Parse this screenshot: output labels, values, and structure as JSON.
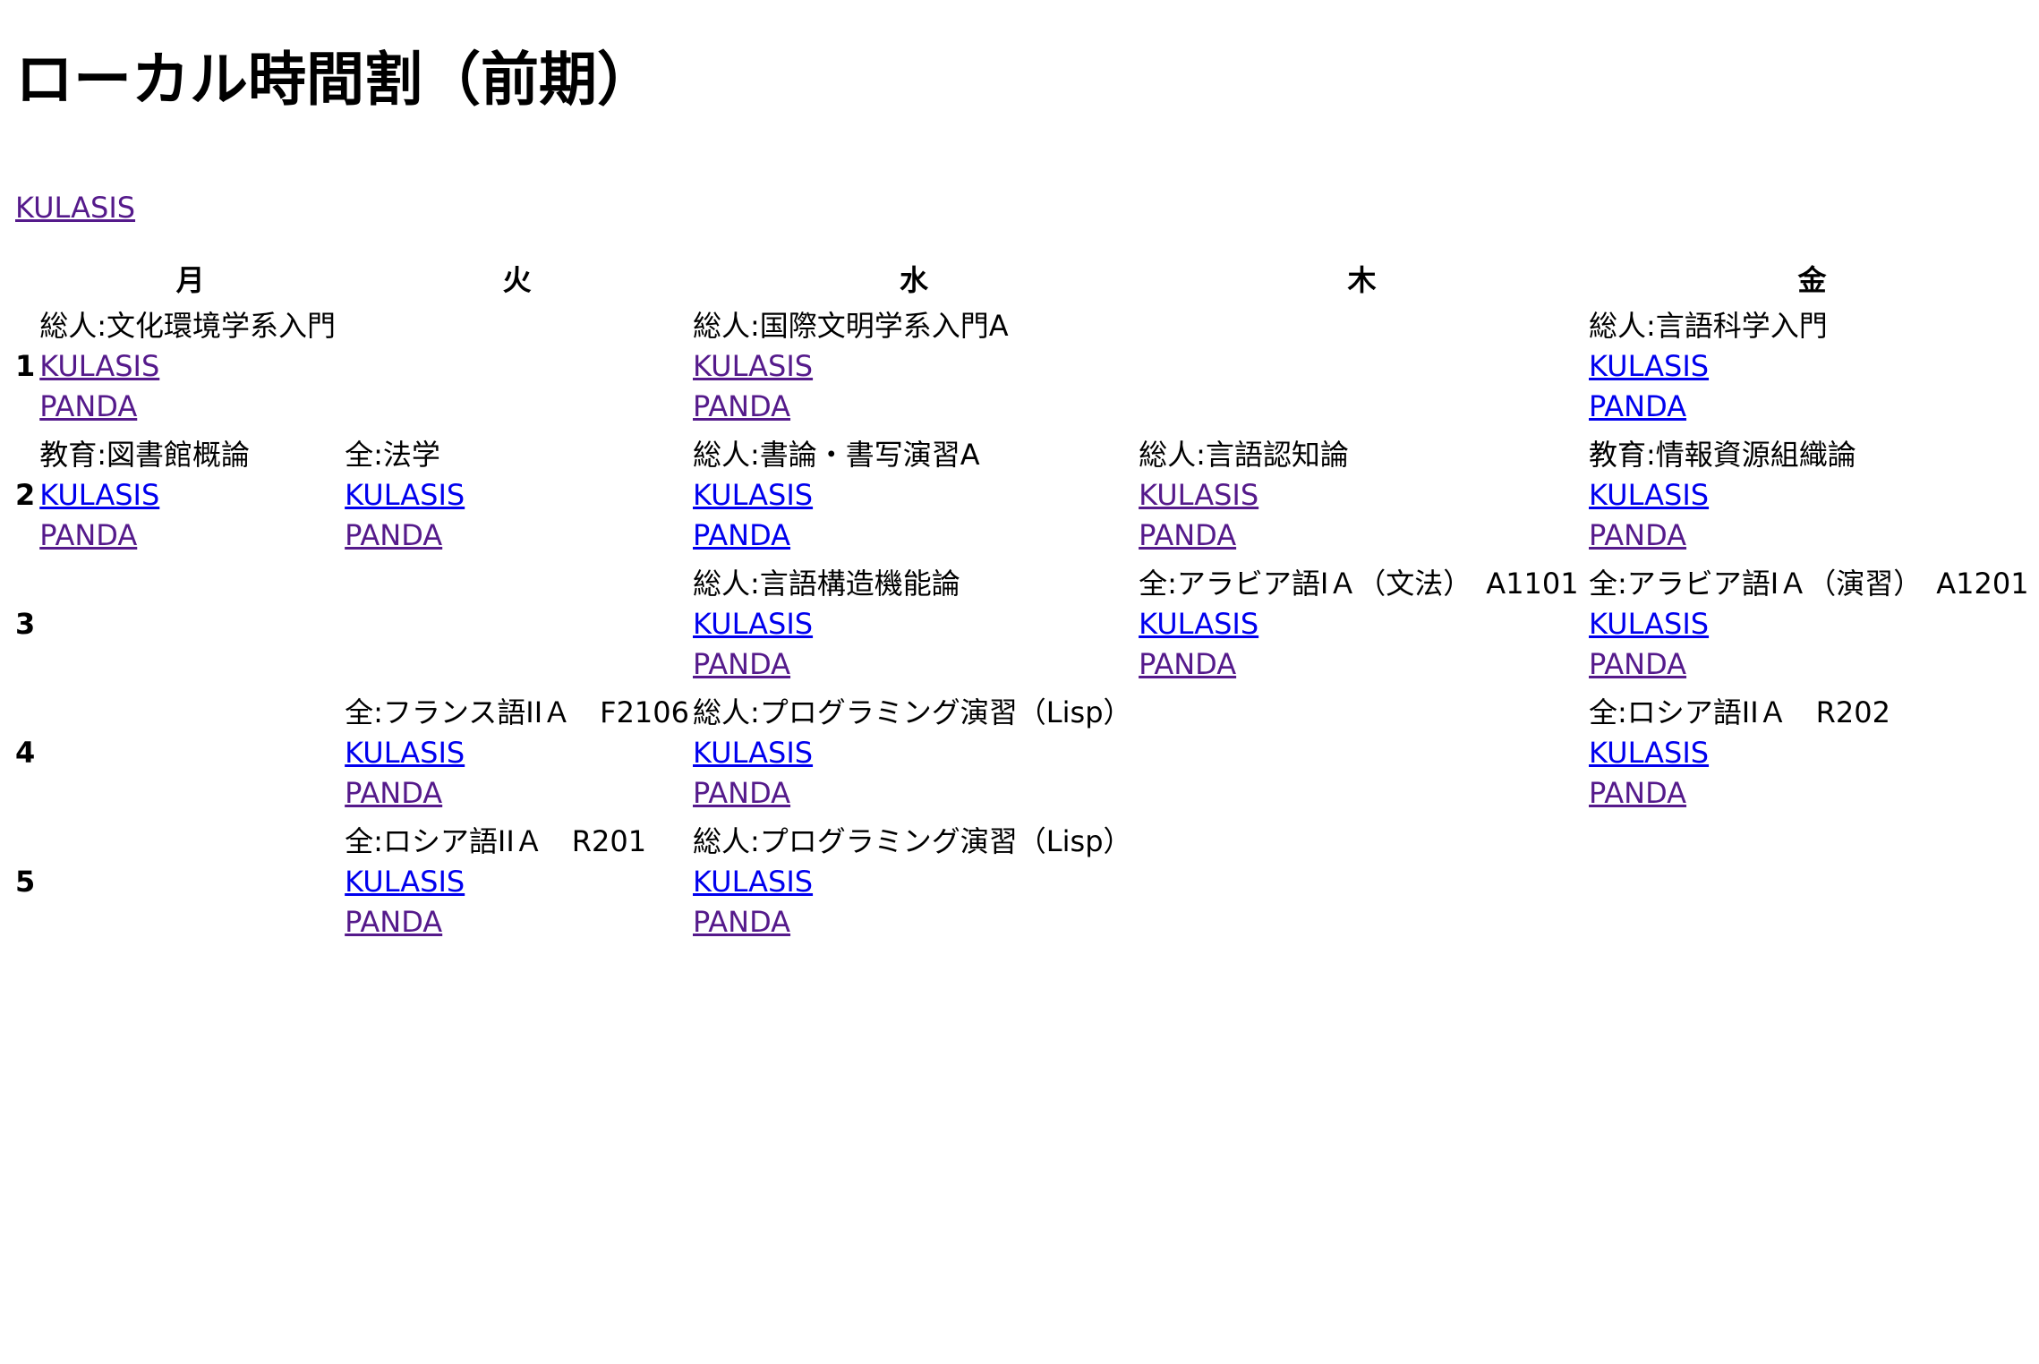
{
  "page": {
    "title": "ローカル時間割（前期）",
    "top_link": "KULASIS"
  },
  "colors": {
    "visited_link": "#551a8b",
    "unvisited_link": "#0000ee"
  },
  "days": [
    "月",
    "火",
    "水",
    "木",
    "金"
  ],
  "periods": [
    {
      "label": "1",
      "cells": [
        {
          "title": "総人:文化環境学系入門",
          "kulasis": "KULASIS",
          "panda": "PANDA",
          "kulasis_visited": true,
          "panda_visited": true
        },
        null,
        {
          "title": "総人:国際文明学系入門A",
          "kulasis": "KULASIS",
          "panda": "PANDA",
          "kulasis_visited": true,
          "panda_visited": true
        },
        null,
        {
          "title": "総人:言語科学入門",
          "kulasis": "KULASIS",
          "panda": "PANDA",
          "kulasis_visited": false,
          "panda_visited": false
        }
      ]
    },
    {
      "label": "2",
      "cells": [
        {
          "title": "教育:図書館概論",
          "kulasis": "KULASIS",
          "panda": "PANDA",
          "kulasis_visited": false,
          "panda_visited": true
        },
        {
          "title": "全:法学",
          "kulasis": "KULASIS",
          "panda": "PANDA",
          "kulasis_visited": false,
          "panda_visited": true
        },
        {
          "title": "総人:書論・書写演習A",
          "kulasis": "KULASIS",
          "panda": "PANDA",
          "kulasis_visited": false,
          "panda_visited": false
        },
        {
          "title": "総人:言語認知論",
          "kulasis": "KULASIS",
          "panda": "PANDA",
          "kulasis_visited": true,
          "panda_visited": true
        },
        {
          "title": "教育:情報資源組織論",
          "kulasis": "KULASIS",
          "panda": "PANDA",
          "kulasis_visited": false,
          "panda_visited": true
        }
      ]
    },
    {
      "label": "3",
      "cells": [
        null,
        null,
        {
          "title": "総人:言語構造機能論",
          "kulasis": "KULASIS",
          "panda": "PANDA",
          "kulasis_visited": false,
          "panda_visited": true
        },
        {
          "title": "全:アラビア語ⅠＡ（文法）　A1101",
          "kulasis": "KULASIS",
          "panda": "PANDA",
          "kulasis_visited": false,
          "panda_visited": true
        },
        {
          "title": "全:アラビア語ⅠＡ（演習）　A1201",
          "kulasis": "KULASIS",
          "panda": "PANDA",
          "kulasis_visited": false,
          "panda_visited": true
        }
      ]
    },
    {
      "label": "4",
      "cells": [
        null,
        {
          "title": "全:フランス語IIＡ　F2106",
          "kulasis": "KULASIS",
          "panda": "PANDA",
          "kulasis_visited": false,
          "panda_visited": true
        },
        {
          "title": "総人:プログラミング演習（Lisp）",
          "kulasis": "KULASIS",
          "panda": "PANDA",
          "kulasis_visited": false,
          "panda_visited": true
        },
        null,
        {
          "title": "全:ロシア語IIＡ　R202",
          "kulasis": "KULASIS",
          "panda": "PANDA",
          "kulasis_visited": false,
          "panda_visited": true
        }
      ]
    },
    {
      "label": "5",
      "cells": [
        null,
        {
          "title": "全:ロシア語IIＡ　R201",
          "kulasis": "KULASIS",
          "panda": "PANDA",
          "kulasis_visited": false,
          "panda_visited": true
        },
        {
          "title": "総人:プログラミング演習（Lisp）",
          "kulasis": "KULASIS",
          "panda": "PANDA",
          "kulasis_visited": false,
          "panda_visited": true
        },
        null,
        null
      ]
    }
  ]
}
